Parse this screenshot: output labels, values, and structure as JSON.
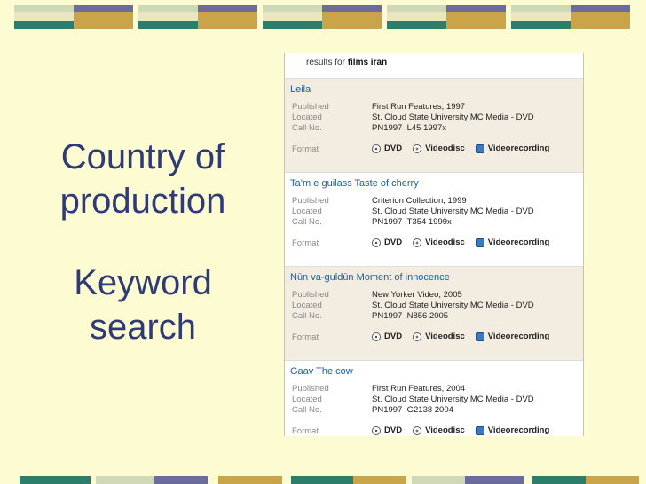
{
  "slide": {
    "heading": [
      "Country of",
      "production"
    ],
    "subheading": [
      "Keyword",
      "search"
    ]
  },
  "results": {
    "header_prefix": "results for",
    "query_terms": "films iran",
    "field_labels": {
      "published": "Published",
      "located": "Located",
      "call_no": "Call No.",
      "format": "Format"
    },
    "formats": {
      "dvd": "DVD",
      "videodisc": "Videodisc",
      "videorecording": "Videorecording"
    },
    "records": [
      {
        "title": "Leila",
        "published": "First Run Features, 1997",
        "located": "St. Cloud State University MC Media - DVD",
        "call_no": "PN1997 .L45 1997x"
      },
      {
        "title": "Ta’m e guilass Taste of cherry",
        "published": "Criterion Collection, 1999",
        "located": "St. Cloud State University MC Media - DVD",
        "call_no": "PN1997 .T354 1999x"
      },
      {
        "title": "Nūn va-guldūn Moment of innocence",
        "published": "New Yorker Video, 2005",
        "located": "St. Cloud State University MC Media - DVD",
        "call_no": "PN1997 .N856 2005"
      },
      {
        "title": "Gaav The cow",
        "published": "First Run Features, 2004",
        "located": "St. Cloud State University MC Media - DVD",
        "call_no": "PN1997 .G2138 2004"
      }
    ]
  },
  "colors": {
    "background": "#fdfbd2",
    "title_text": "#2f3a76",
    "band_teal": "#2b7e6a",
    "band_gold": "#c9a449",
    "band_purple": "#6b6c9b",
    "band_light": "#cfd9b8",
    "link": "#1b5fa8"
  }
}
